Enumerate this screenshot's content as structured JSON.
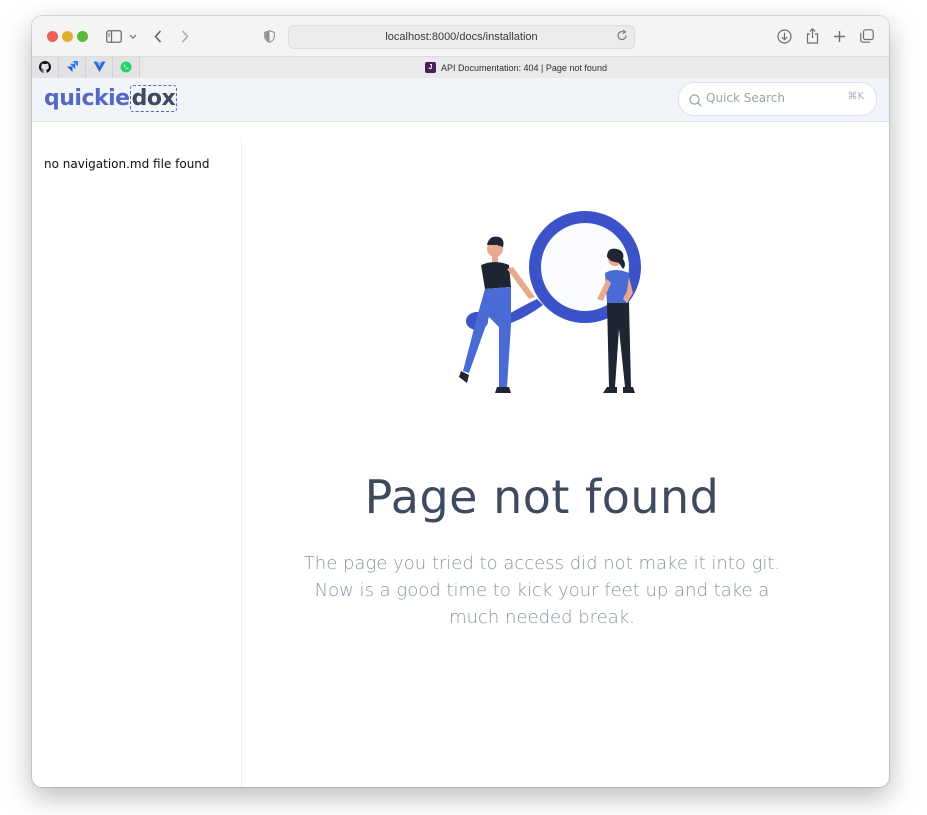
{
  "browser": {
    "url": "localhost:8000/docs/installation",
    "tab_title": "API Documentation: 404 | Page not found",
    "favicon_letter": "J",
    "pinned_tabs": [
      "github-icon",
      "jira-icon",
      "vue-icon",
      "whatsapp-icon"
    ]
  },
  "site": {
    "logo_part1": "quickie",
    "logo_part2": "dox",
    "search_placeholder": "Quick Search",
    "search_shortcut": "⌘K"
  },
  "sidebar": {
    "message": "no navigation.md file found"
  },
  "error_page": {
    "title": "Page not found",
    "description": "The page you tried to access did not make it into git. Now is a good time to kick your feet up and take a much needed break."
  },
  "colors": {
    "accent": "#3b52c9",
    "heading": "#3f4a5e",
    "muted_text": "#8a96a6",
    "header_bg": "#f1f5f9"
  }
}
